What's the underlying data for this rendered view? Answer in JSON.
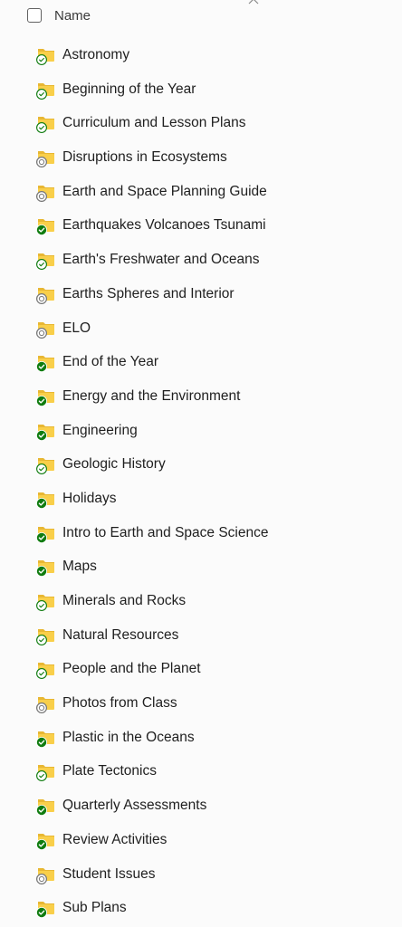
{
  "header": {
    "name_label": "Name"
  },
  "colors": {
    "folder_back": "#e8b733",
    "folder_front": "#f9cf4a",
    "synced": "#107c10",
    "available": "#107c10",
    "cloud": "#7a7a7a"
  },
  "items": [
    {
      "label": "Astronomy",
      "status": "available"
    },
    {
      "label": "Beginning of the Year",
      "status": "available"
    },
    {
      "label": "Curriculum and Lesson Plans",
      "status": "available"
    },
    {
      "label": "Disruptions in Ecosystems",
      "status": "cloud"
    },
    {
      "label": "Earth and Space Planning Guide",
      "status": "cloud"
    },
    {
      "label": "Earthquakes Volcanoes Tsunami",
      "status": "synced"
    },
    {
      "label": "Earth's Freshwater and Oceans",
      "status": "available"
    },
    {
      "label": "Earths Spheres and Interior",
      "status": "cloud"
    },
    {
      "label": "ELO",
      "status": "cloud"
    },
    {
      "label": "End of the Year",
      "status": "synced"
    },
    {
      "label": "Energy and the Environment",
      "status": "synced"
    },
    {
      "label": "Engineering",
      "status": "synced"
    },
    {
      "label": "Geologic History",
      "status": "available"
    },
    {
      "label": "Holidays",
      "status": "synced"
    },
    {
      "label": "Intro to Earth and Space Science",
      "status": "synced"
    },
    {
      "label": "Maps",
      "status": "synced"
    },
    {
      "label": "Minerals and Rocks",
      "status": "available"
    },
    {
      "label": "Natural Resources",
      "status": "available"
    },
    {
      "label": "People and the Planet",
      "status": "available"
    },
    {
      "label": "Photos from Class",
      "status": "cloud"
    },
    {
      "label": "Plastic in the Oceans",
      "status": "synced"
    },
    {
      "label": "Plate Tectonics",
      "status": "available"
    },
    {
      "label": "Quarterly Assessments",
      "status": "synced"
    },
    {
      "label": "Review Activities",
      "status": "synced"
    },
    {
      "label": "Student Issues",
      "status": "cloud"
    },
    {
      "label": "Sub Plans",
      "status": "synced"
    }
  ]
}
